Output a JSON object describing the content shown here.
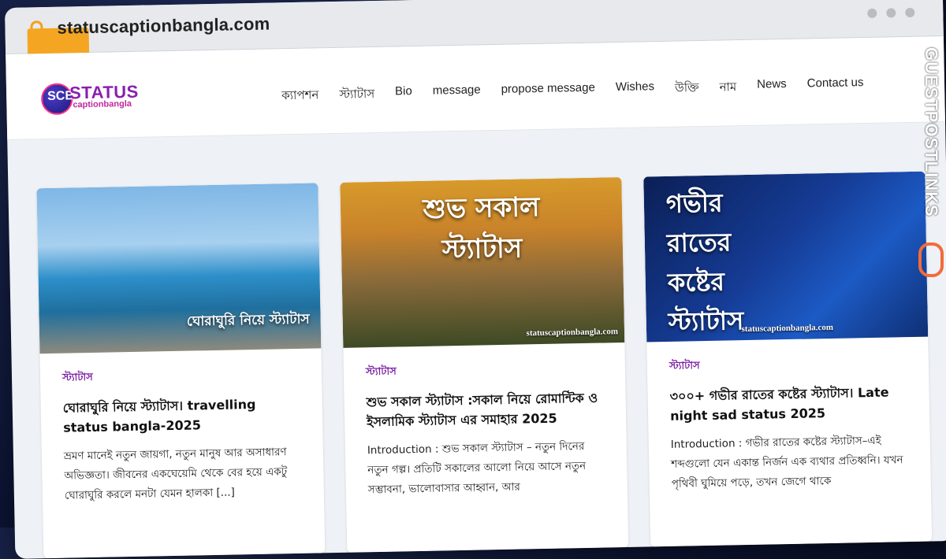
{
  "browser": {
    "url": "statuscaptionbangla.com"
  },
  "site": {
    "logo_text": "STATUS",
    "logo_sub": "captionbangla",
    "logo_mark": "SCB"
  },
  "nav": [
    "ক্যাপশন",
    "স্ট্যাটাস",
    "Bio",
    "message",
    "propose message",
    "Wishes",
    "উক্তি",
    "নাম",
    "News",
    "Contact us"
  ],
  "cards": [
    {
      "image_caption": "ঘোরাঘুরি নিয়ে স্ট্যাটাস",
      "image_site": "",
      "category": "স্ট্যাটাস",
      "title": "ঘোরাঘুরি নিয়ে স্ট্যাটাস। travelling status bangla-2025",
      "excerpt": "ভ্রমণ মানেই নতুন জায়গা, নতুন মানুষ আর অসাধারণ অভিজ্ঞতা। জীবনের একঘেয়েমি থেকে বের হয়ে একটু ঘোরাঘুরি করলে মনটা যেমন হালকা [...]"
    },
    {
      "image_caption": "শুভ সকাল স্ট্যাটাস",
      "image_site": "statuscaptionbangla.com",
      "category": "স্ট্যাটাস",
      "title": "শুভ সকাল স্ট্যাটাস :সকাল নিয়ে রোমান্টিক ও ইসলামিক স্ট্যাটাস এর সমাহার 2025",
      "excerpt": "Introduction : শুভ সকাল স্ট্যাটাস – নতুন দিনের নতুন গল্প। প্রতিটি সকালের আলো নিয়ে আসে নতুন সম্ভাবনা, ভালোবাসার আহ্বান, আর"
    },
    {
      "image_caption": "গভীর রাতের কষ্টের স্ট্যাটাস",
      "image_site": "statuscaptionbangla.com",
      "category": "স্ট্যাটাস",
      "title": "৩০০+ গভীর রাতের কষ্টের স্ট্যাটাস। Late night sad status 2025",
      "excerpt": "Introduction : গভীর রাতের কষ্টের স্ট্যাটাস–এই শব্দগুলো যেন একান্ত নির্জন এক ব্যথার প্রতিধ্বনি। যখন পৃথিবী ঘুমিয়ে পড়ে, তখন জেগে থাকে"
    }
  ],
  "watermark": {
    "text": "GUESTPOSTLINKS"
  }
}
